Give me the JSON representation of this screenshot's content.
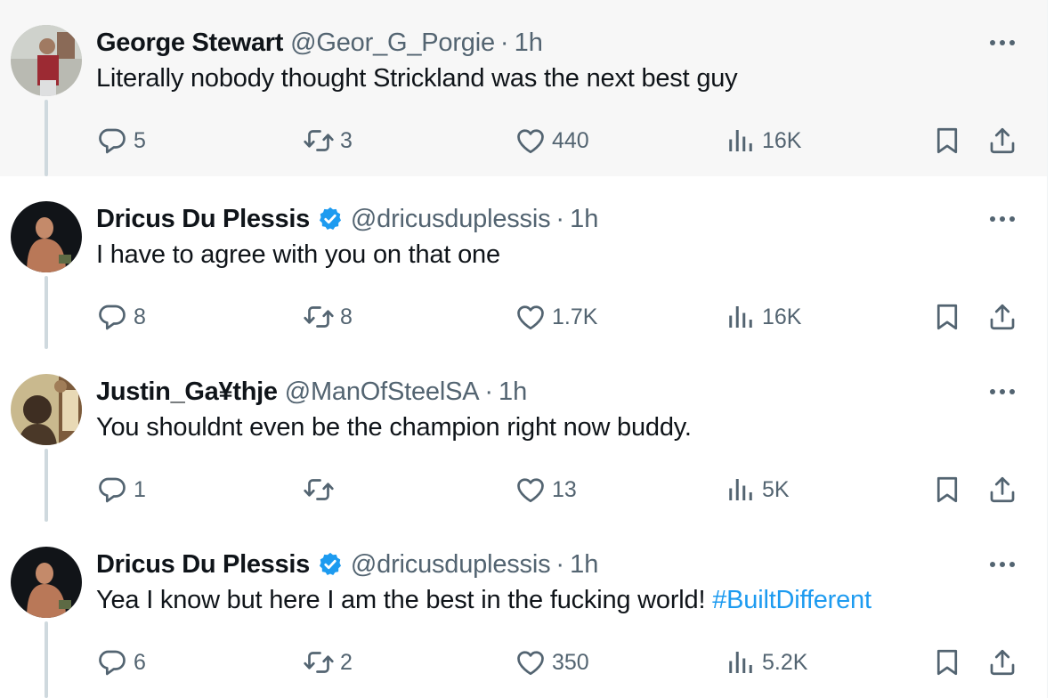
{
  "colors": {
    "accent": "#1d9bf0",
    "muted": "#536471",
    "text": "#0f1419",
    "highlight_bg": "#f7f7f7"
  },
  "tweets": [
    {
      "name": "George Stewart",
      "verified": false,
      "handle": "@Geor_G_Porgie",
      "dot": "·",
      "time": "1h",
      "text": "Literally nobody thought Strickland was the next best guy",
      "hashtag": "",
      "replies": "5",
      "retweets": "3",
      "likes": "440",
      "views": "16K"
    },
    {
      "name": "Dricus Du Plessis",
      "verified": true,
      "handle": "@dricusduplessis",
      "dot": "·",
      "time": "1h",
      "text": "I have to agree with you on that one",
      "hashtag": "",
      "replies": "8",
      "retweets": "8",
      "likes": "1.7K",
      "views": "16K"
    },
    {
      "name": "Justin_Ga¥thje",
      "verified": false,
      "handle": "@ManOfSteelSA",
      "dot": "·",
      "time": "1h",
      "text": "You shouldnt even be the champion right now buddy.",
      "hashtag": "",
      "replies": "1",
      "retweets": "",
      "likes": "13",
      "views": "5K"
    },
    {
      "name": "Dricus Du Plessis",
      "verified": true,
      "handle": "@dricusduplessis",
      "dot": "·",
      "time": "1h",
      "text": "Yea I know but here I am the best in the fucking world! ",
      "hashtag": "#BuiltDifferent",
      "replies": "6",
      "retweets": "2",
      "likes": "350",
      "views": "5.2K"
    }
  ]
}
